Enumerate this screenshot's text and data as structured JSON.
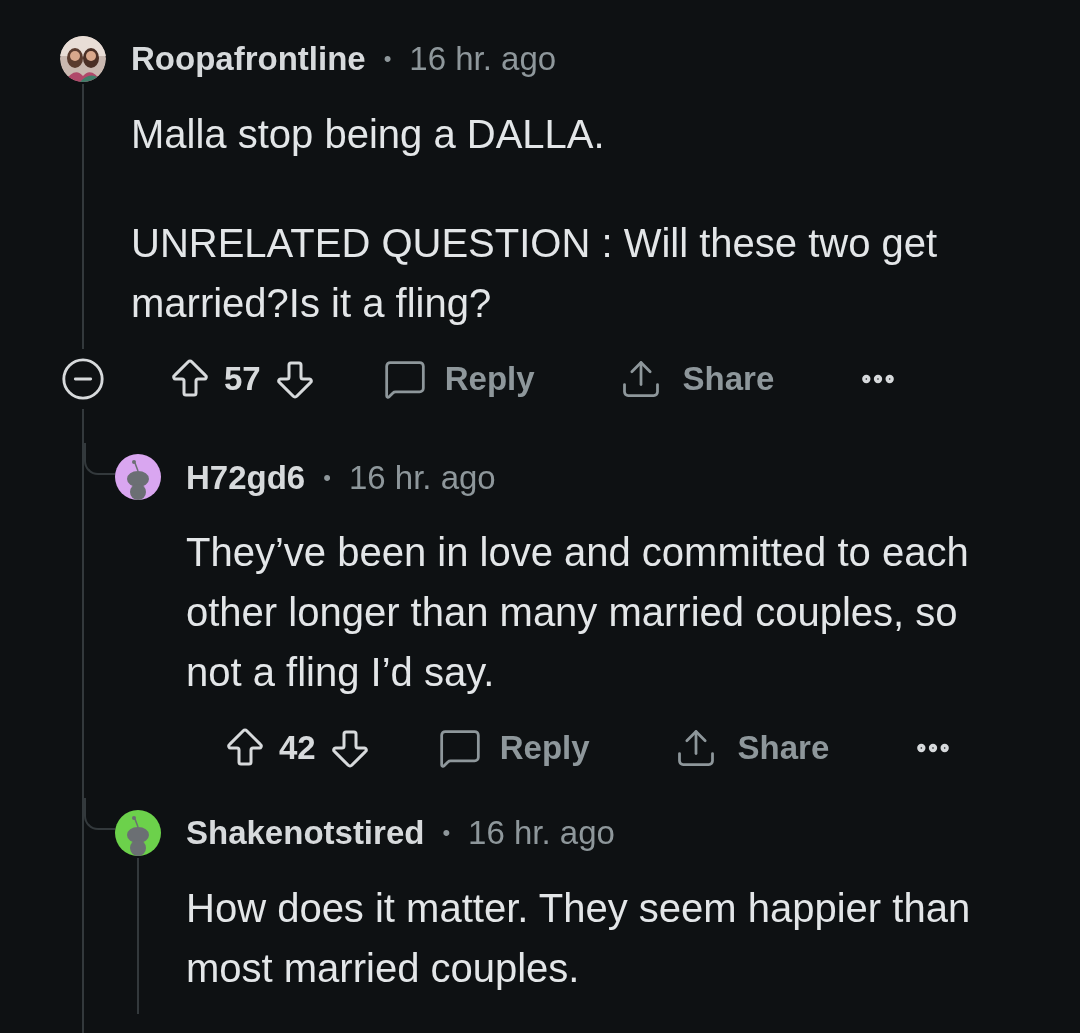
{
  "comments": [
    {
      "author": "Roopafrontline",
      "separator": "•",
      "time": "16 hr. ago",
      "paragraphs": [
        "Malla stop being a DALLA.",
        "UNRELATED QUESTION : Will these two get married?Is it a fling?"
      ],
      "expanded": true,
      "votes": "57",
      "reply": "Reply",
      "share": "Share",
      "thread_line": true,
      "replies": [
        {
          "author": "H72gd6",
          "separator": "•",
          "time": "16 hr. ago",
          "avatar": {
            "kind": "snoo",
            "color": "#d9a6f0"
          },
          "paragraphs": [
            "They’ve been in love and committed to each other longer than many married couples, so not a fling I’d say."
          ],
          "votes": "42",
          "reply": "Reply",
          "share": "Share",
          "thread_line": false
        },
        {
          "author": "Shakenotstired",
          "separator": "•",
          "time": "16 hr. ago",
          "avatar": {
            "kind": "snoo",
            "color": "#6cd14b"
          },
          "paragraphs": [
            "How does it matter. They seem happier than most married couples."
          ],
          "thread_line": true
        }
      ]
    }
  ]
}
